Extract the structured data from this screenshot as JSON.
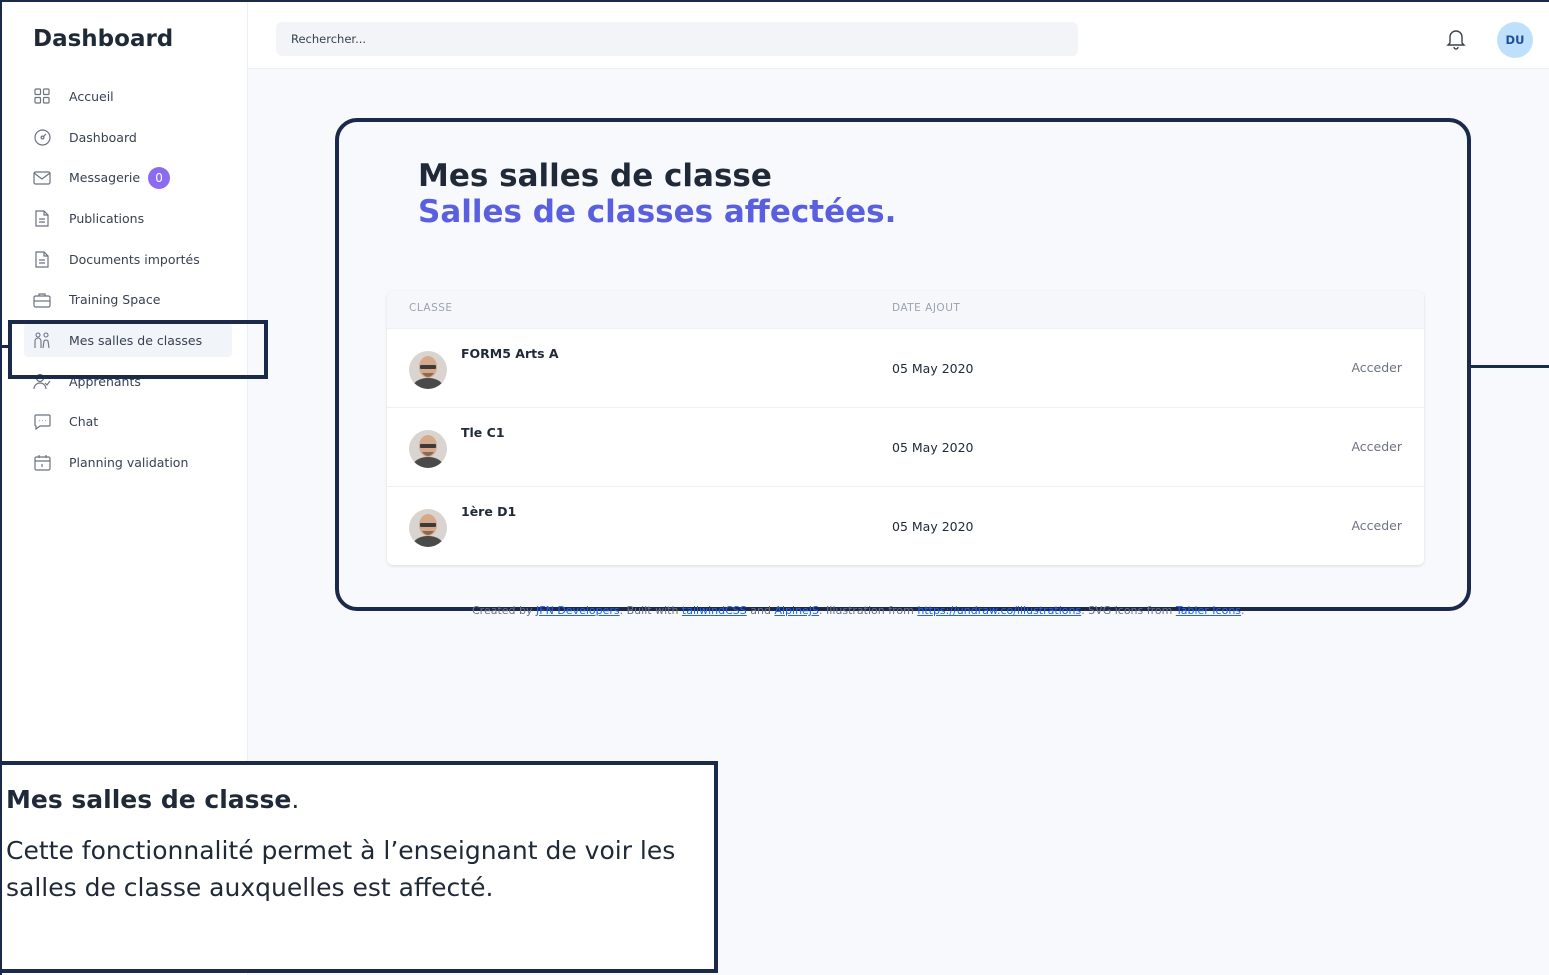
{
  "sidebar": {
    "brand": "Dashboard",
    "items": [
      {
        "label": "Accueil",
        "icon": "grid-icon"
      },
      {
        "label": "Dashboard",
        "icon": "gauge-icon"
      },
      {
        "label": "Messagerie",
        "icon": "mail-icon",
        "badge": "0"
      },
      {
        "label": "Publications",
        "icon": "document-icon"
      },
      {
        "label": "Documents importés",
        "icon": "document-icon"
      },
      {
        "label": "Training Space",
        "icon": "briefcase-icon"
      },
      {
        "label": "Mes salles de classes",
        "icon": "users-icon",
        "active": true
      },
      {
        "label": "Apprenants",
        "icon": "user-check-icon"
      },
      {
        "label": "Chat",
        "icon": "chat-icon"
      },
      {
        "label": "Planning validation",
        "icon": "calendar-icon"
      }
    ]
  },
  "header": {
    "search_placeholder": "Rechercher...",
    "avatar_initials": "DU"
  },
  "main": {
    "title": "Mes salles de classe",
    "subtitle": "Salles de classes affectées.",
    "table": {
      "columns": [
        "CLASSE",
        "DATE AJOUT"
      ],
      "rows": [
        {
          "name": "FORM5 Arts A",
          "date": "05 May 2020",
          "action": "Acceder"
        },
        {
          "name": "Tle C1",
          "date": "05 May 2020",
          "action": "Acceder"
        },
        {
          "name": "1ère D1",
          "date": "05 May 2020",
          "action": "Acceder"
        }
      ]
    }
  },
  "footer": {
    "prefix": "Created by ",
    "author": "JFN Developers",
    "mid1": ". Built with ",
    "lib1": "tailwindCSS",
    "mid2": " and ",
    "lib2": "AlpineJS",
    "mid3": ". Illustration from ",
    "illus": "https://undraw.co/illustrations",
    "mid4": ". SVG icons from ",
    "icons": "Tabler Icons",
    "suffix": "."
  },
  "note": {
    "title": "Mes salles de classe",
    "period": ".",
    "body": "Cette fonctionnalité permet à l’enseignant de voir les salles de classe auxquelles est affecté."
  },
  "colors": {
    "accent": "#5a5fe0",
    "badge": "#8b6cf0",
    "frame": "#1b2a4a"
  }
}
